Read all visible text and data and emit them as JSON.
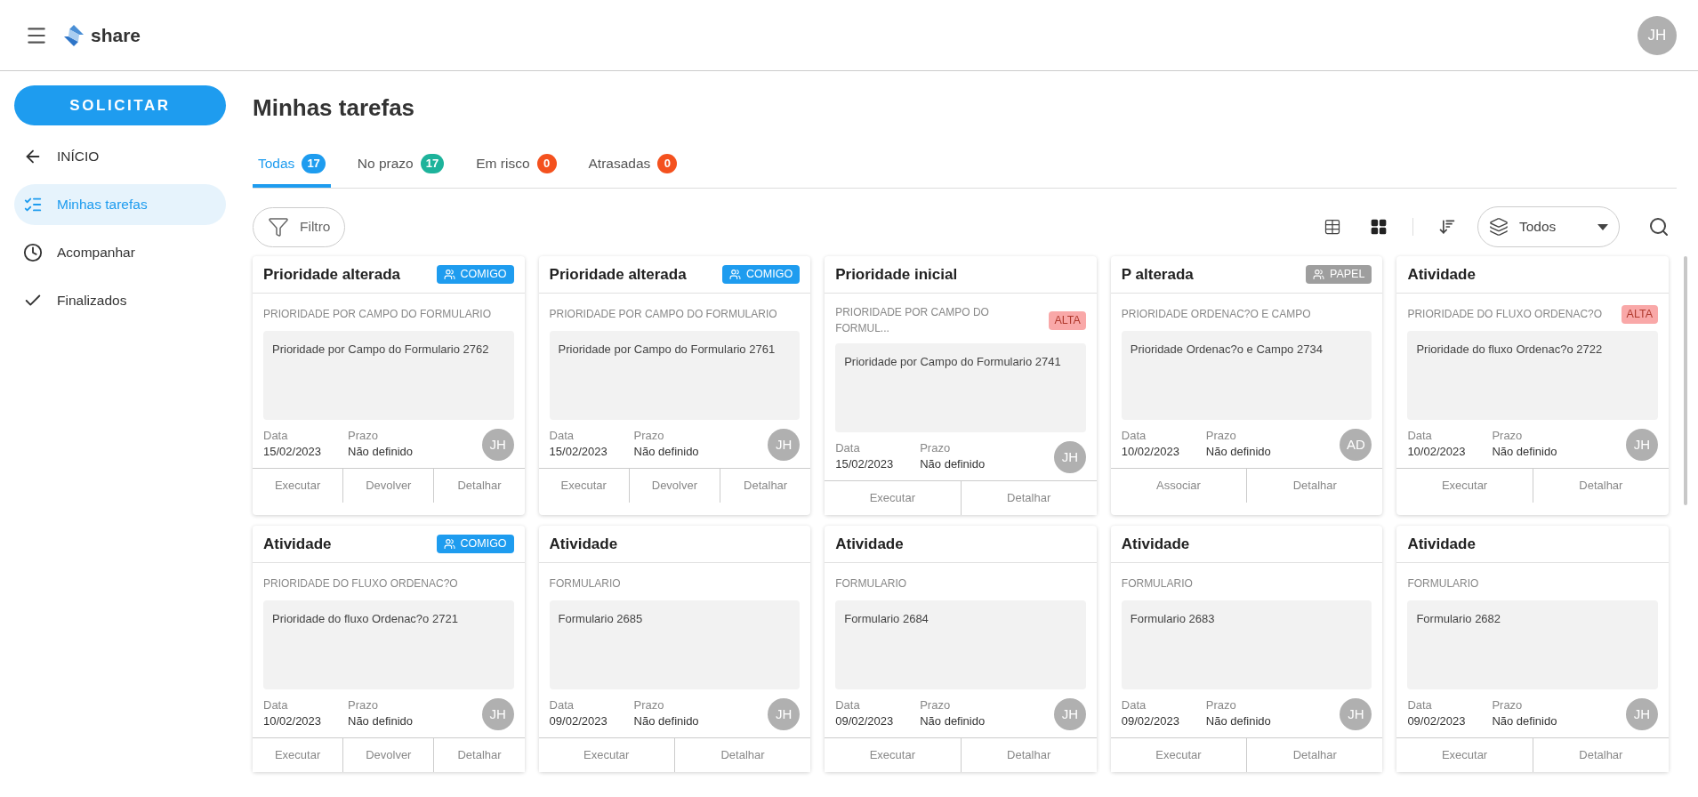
{
  "header": {
    "brand": "share",
    "user_initials": "JH"
  },
  "sidebar": {
    "action": "SOLICITAR",
    "items": [
      {
        "kind": "back",
        "label": "INÍCIO",
        "selected": false
      },
      {
        "kind": "tasks",
        "label": "Minhas tarefas",
        "selected": true
      },
      {
        "kind": "clock",
        "label": "Acompanhar",
        "selected": false
      },
      {
        "kind": "check",
        "label": "Finalizados",
        "selected": false
      }
    ]
  },
  "page": {
    "title": "Minhas tarefas"
  },
  "tabs": [
    {
      "label": "Todas",
      "count": "17",
      "color": "#1e9cef",
      "selected": true
    },
    {
      "label": "No prazo",
      "count": "17",
      "color": "#1db39b",
      "selected": false
    },
    {
      "label": "Em risco",
      "count": "0",
      "color": "#f4511e",
      "selected": false
    },
    {
      "label": "Atrasadas",
      "count": "0",
      "color": "#f4511e",
      "selected": false
    }
  ],
  "toolbar": {
    "filter": "Filtro",
    "scope": "Todos"
  },
  "cards": [
    {
      "title": "Prioridade alterada",
      "badge": {
        "text": "COMIGO",
        "color": "#1e9cef"
      },
      "category": "PRIORIDADE POR CAMPO DO FORMULARIO",
      "description": "Prioridade por Campo do Formulario 2762",
      "date_label": "Data",
      "date": "15/02/2023",
      "deadline_label": "Prazo",
      "deadline": "Não definido",
      "assignee": "JH",
      "actions": [
        "Executar",
        "Devolver",
        "Detalhar"
      ]
    },
    {
      "title": "Prioridade alterada",
      "badge": {
        "text": "COMIGO",
        "color": "#1e9cef"
      },
      "category": "PRIORIDADE POR CAMPO DO FORMULARIO",
      "description": "Prioridade por Campo do Formulario 2761",
      "date_label": "Data",
      "date": "15/02/2023",
      "deadline_label": "Prazo",
      "deadline": "Não definido",
      "assignee": "JH",
      "actions": [
        "Executar",
        "Devolver",
        "Detalhar"
      ]
    },
    {
      "title": "Prioridade inicial",
      "category": "PRIORIDADE POR CAMPO DO FORMUL...",
      "priority": "ALTA",
      "description": "Prioridade por Campo do Formulario 2741",
      "date_label": "Data",
      "date": "15/02/2023",
      "deadline_label": "Prazo",
      "deadline": "Não definido",
      "assignee": "JH",
      "actions": [
        "Executar",
        "Detalhar"
      ]
    },
    {
      "title": "P alterada",
      "badge": {
        "text": "PAPEL",
        "color": "#9e9e9e"
      },
      "category": "PRIORIDADE ORDENAC?O E CAMPO",
      "description": "Prioridade Ordenac?o e Campo 2734",
      "date_label": "Data",
      "date": "10/02/2023",
      "deadline_label": "Prazo",
      "deadline": "Não definido",
      "assignee": "AD",
      "actions": [
        "Associar",
        "Detalhar"
      ]
    },
    {
      "title": "Atividade",
      "category": "PRIORIDADE DO FLUXO ORDENAC?O",
      "priority": "ALTA",
      "description": "Prioridade do fluxo Ordenac?o 2722",
      "date_label": "Data",
      "date": "10/02/2023",
      "deadline_label": "Prazo",
      "deadline": "Não definido",
      "assignee": "JH",
      "actions": [
        "Executar",
        "Detalhar"
      ]
    },
    {
      "title": "Atividade",
      "badge": {
        "text": "COMIGO",
        "color": "#1e9cef"
      },
      "category": "PRIORIDADE DO FLUXO ORDENAC?O",
      "description": "Prioridade do fluxo Ordenac?o 2721",
      "date_label": "Data",
      "date": "10/02/2023",
      "deadline_label": "Prazo",
      "deadline": "Não definido",
      "assignee": "JH",
      "actions": [
        "Executar",
        "Devolver",
        "Detalhar"
      ]
    },
    {
      "title": "Atividade",
      "category": "FORMULARIO",
      "description": "Formulario 2685",
      "date_label": "Data",
      "date": "09/02/2023",
      "deadline_label": "Prazo",
      "deadline": "Não definido",
      "assignee": "JH",
      "actions": [
        "Executar",
        "Detalhar"
      ]
    },
    {
      "title": "Atividade",
      "category": "FORMULARIO",
      "description": "Formulario 2684",
      "date_label": "Data",
      "date": "09/02/2023",
      "deadline_label": "Prazo",
      "deadline": "Não definido",
      "assignee": "JH",
      "actions": [
        "Executar",
        "Detalhar"
      ]
    },
    {
      "title": "Atividade",
      "category": "FORMULARIO",
      "description": "Formulario 2683",
      "date_label": "Data",
      "date": "09/02/2023",
      "deadline_label": "Prazo",
      "deadline": "Não definido",
      "assignee": "JH",
      "actions": [
        "Executar",
        "Detalhar"
      ]
    },
    {
      "title": "Atividade",
      "category": "FORMULARIO",
      "description": "Formulario 2682",
      "date_label": "Data",
      "date": "09/02/2023",
      "deadline_label": "Prazo",
      "deadline": "Não definido",
      "assignee": "JH",
      "actions": [
        "Executar",
        "Detalhar"
      ]
    }
  ]
}
